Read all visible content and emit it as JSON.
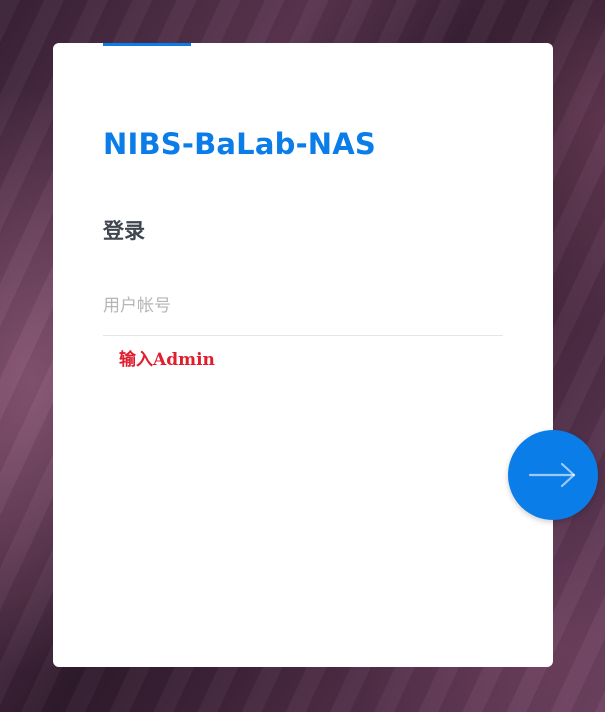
{
  "card": {
    "title": "NIBS-BaLab-NAS",
    "heading": "登录"
  },
  "form": {
    "username": {
      "placeholder": "用户帐号",
      "value": ""
    },
    "hint": "输入Admin"
  },
  "actions": {
    "next_icon": "arrow-right-icon"
  },
  "colors": {
    "accent": "#0a7de8",
    "hint": "#e01e2e",
    "heading": "#3f4650"
  }
}
